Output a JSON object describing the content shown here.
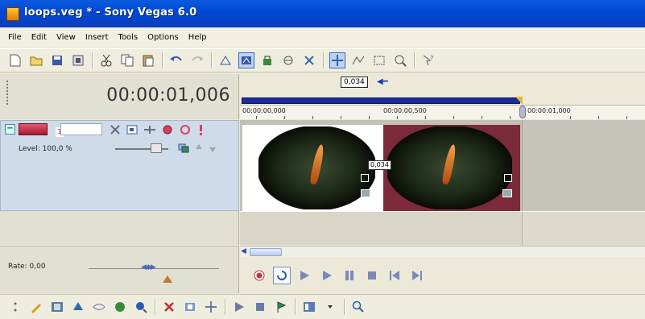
{
  "window": {
    "title": "loops.veg * - Sony Vegas 6.0"
  },
  "menu": {
    "items": [
      "File",
      "Edit",
      "View",
      "Insert",
      "Tools",
      "Options",
      "Help"
    ]
  },
  "timeline": {
    "current_time": "00:00:01,006",
    "cursor_label": "0,034",
    "ruler_labels": [
      "00:00:00,000",
      "00:00:00,500",
      "00:00:01,000"
    ]
  },
  "track": {
    "number": "1",
    "level_label": "Level: 100,0 %",
    "level_value": 1.0,
    "crossfade_label": "0,034"
  },
  "transport": {
    "rate_label": "Rate: 0,00"
  },
  "colors": {
    "loop_region": "#1b2c9c",
    "event_dark": "#7a2a3a",
    "track_header": "#cfdbe9"
  }
}
